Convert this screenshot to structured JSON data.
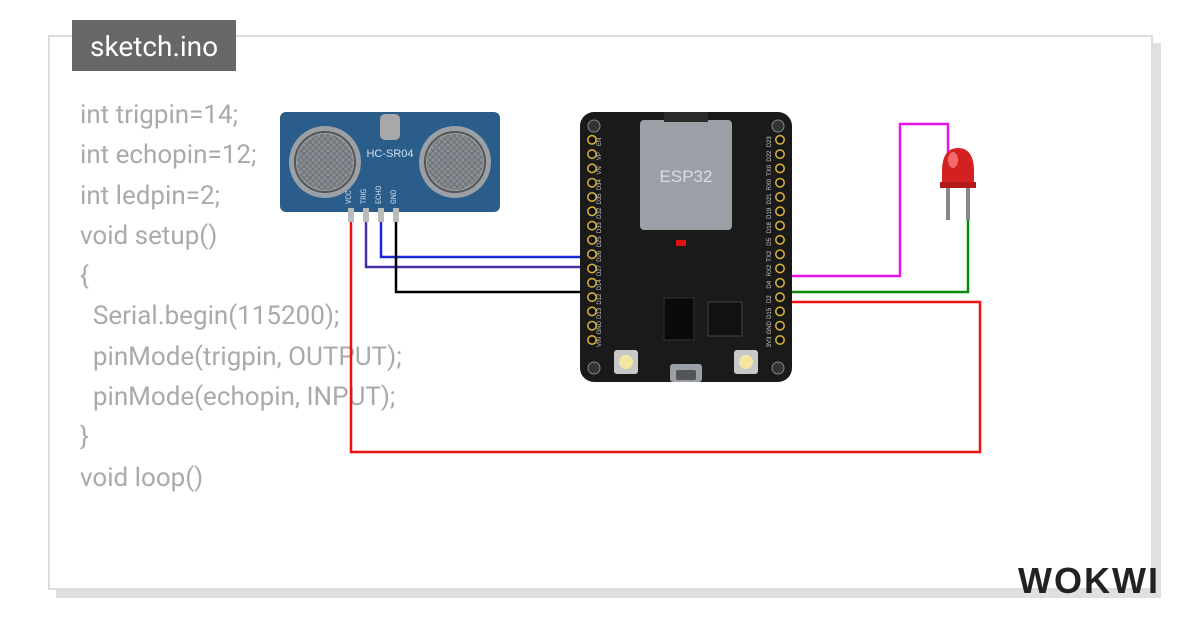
{
  "tab_label": "sketch.ino",
  "code_lines": [
    "int trigpin=14;",
    "int echopin=12;",
    "int ledpin=2;",
    "void setup()",
    "{",
    "  Serial.begin(115200);",
    "  pinMode(trigpin, OUTPUT);",
    "  pinMode(echopin, INPUT);",
    "}",
    "void loop()"
  ],
  "components": {
    "sensor": {
      "label": "HC-SR04",
      "pins": [
        "VCC",
        "TRIG",
        "ECHO",
        "GND"
      ]
    },
    "board": {
      "label": "ESP32",
      "pins_left": [
        "VIN",
        "GND",
        "D13",
        "D12",
        "D14",
        "D27",
        "D26",
        "D25",
        "D33",
        "D32",
        "D35",
        "D34",
        "VN",
        "VP",
        "EN"
      ],
      "pins_right": [
        "3V3",
        "GND",
        "D15",
        "D2",
        "D4",
        "RX2",
        "TX2",
        "D5",
        "D18",
        "D19",
        "D21",
        "RX0",
        "TX0",
        "D22",
        "D23"
      ]
    },
    "led": {
      "color": "red"
    }
  },
  "wires": [
    {
      "from": "HC-SR04.VCC",
      "to": "ESP32.VIN",
      "color": "#e11"
    },
    {
      "from": "HC-SR04.TRIG",
      "to": "ESP32.D14",
      "color": "#4a2ea8"
    },
    {
      "from": "HC-SR04.ECHO",
      "to": "ESP32.D12",
      "color": "#1929d6"
    },
    {
      "from": "HC-SR04.GND",
      "to": "ESP32.GND",
      "color": "#000"
    },
    {
      "from": "LED.anode",
      "to": "ESP32.D2",
      "color": "#e815e8"
    },
    {
      "from": "LED.cathode",
      "to": "ESP32.GND",
      "color": "#0a8a0a"
    }
  ],
  "brand": "WOKWI"
}
